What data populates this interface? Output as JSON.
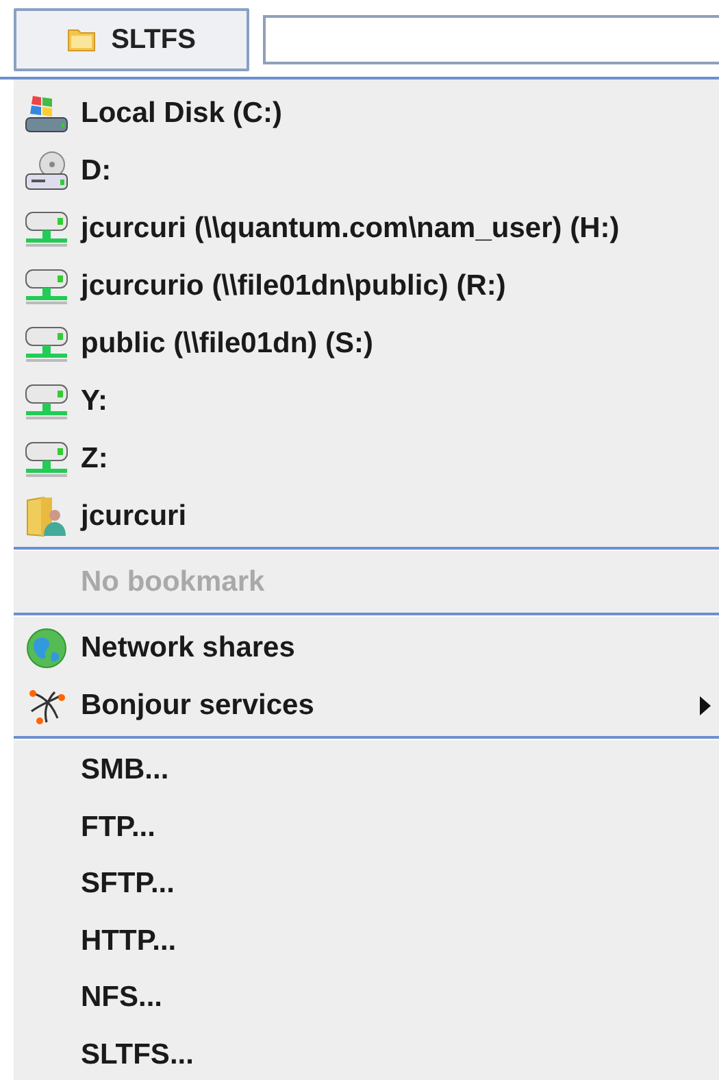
{
  "toolbar": {
    "button": "SLTFS"
  },
  "menu": {
    "sections": [
      {
        "items": [
          {
            "kind": "local-disk",
            "label": "Local Disk (C:)",
            "disabled": false,
            "submenu": false
          },
          {
            "kind": "optical-drive",
            "label": "D:",
            "disabled": false,
            "submenu": false
          },
          {
            "kind": "network-drive",
            "label": "jcurcuri (\\\\quantum.com\\nam_user) (H:)",
            "disabled": false,
            "submenu": false
          },
          {
            "kind": "network-drive",
            "label": "jcurcurio (\\\\file01dn\\public) (R:)",
            "disabled": false,
            "submenu": false
          },
          {
            "kind": "network-drive",
            "label": "public (\\\\file01dn) (S:)",
            "disabled": false,
            "submenu": false
          },
          {
            "kind": "network-drive",
            "label": "Y:",
            "disabled": false,
            "submenu": false
          },
          {
            "kind": "network-drive",
            "label": "Z:",
            "disabled": false,
            "submenu": false
          },
          {
            "kind": "user-folder",
            "label": "jcurcuri",
            "disabled": false,
            "submenu": false
          }
        ]
      },
      {
        "items": [
          {
            "kind": "plain",
            "label": "No bookmark",
            "disabled": true,
            "submenu": false
          }
        ]
      },
      {
        "items": [
          {
            "kind": "globe",
            "label": "Network shares",
            "disabled": false,
            "submenu": false
          },
          {
            "kind": "bonjour",
            "label": "Bonjour services",
            "disabled": false,
            "submenu": true
          }
        ]
      },
      {
        "items": [
          {
            "kind": "plain",
            "label": "SMB...",
            "disabled": false,
            "submenu": false
          },
          {
            "kind": "plain",
            "label": "FTP...",
            "disabled": false,
            "submenu": false
          },
          {
            "kind": "plain",
            "label": "SFTP...",
            "disabled": false,
            "submenu": false
          },
          {
            "kind": "plain",
            "label": "HTTP...",
            "disabled": false,
            "submenu": false
          },
          {
            "kind": "plain",
            "label": "NFS...",
            "disabled": false,
            "submenu": false
          },
          {
            "kind": "plain",
            "label": "SLTFS...",
            "disabled": false,
            "submenu": false
          }
        ]
      }
    ]
  }
}
